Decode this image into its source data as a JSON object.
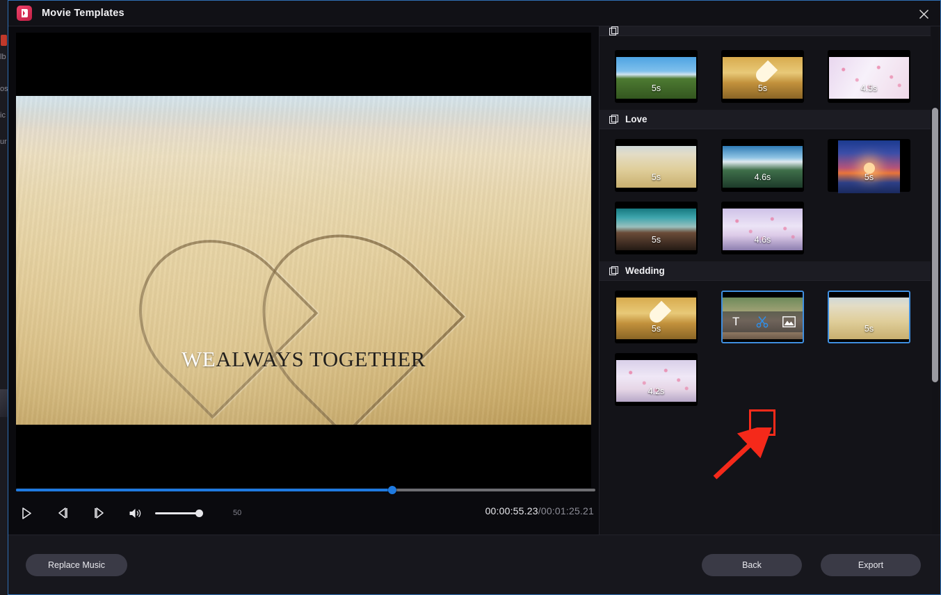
{
  "background_app": {
    "sidebar_fragments": [
      "lb",
      "os",
      "ic",
      "ur"
    ]
  },
  "dialog": {
    "title": "Movie Templates",
    "logo_icon": "filmora-logo-icon",
    "close_icon": "close-icon"
  },
  "preview": {
    "caption_highlight": "WE",
    "caption_rest": "ALWAYS TOGETHER",
    "scene_description": "heart drawn in beach sand",
    "transport": {
      "play_icon": "play-icon",
      "prev_frame_icon": "previous-frame-icon",
      "next_frame_icon": "next-frame-icon",
      "volume_icon": "volume-icon",
      "volume_value": "50",
      "current_time": "00:00:55.23",
      "separator": "/",
      "total_time": "00:01:25.21",
      "progress_percent": 65
    }
  },
  "templates": {
    "scrollbar": {
      "thumb_top_percent": 16,
      "thumb_height_percent": 54
    },
    "sections": [
      {
        "label": "",
        "icon": "stack-icon",
        "partial": true,
        "items": [
          {
            "name": "bike-couple-template",
            "duration": "5s",
            "art": "art-bike",
            "state": "normal"
          },
          {
            "name": "hands-heart-template",
            "duration": "5s",
            "art": "art-hands",
            "state": "normal"
          },
          {
            "name": "pink-petals-template",
            "duration": "4.5s",
            "art": "art-petals",
            "state": "normal"
          }
        ]
      },
      {
        "label": "Love",
        "icon": "stack-icon",
        "items": [
          {
            "name": "sand-heart-template",
            "duration": "5s",
            "art": "art-sandheart",
            "state": "normal"
          },
          {
            "name": "mountain-lake-template",
            "duration": "4.6s",
            "art": "art-lake",
            "state": "normal"
          },
          {
            "name": "ocean-sunset-template",
            "duration": "5s",
            "art": "art-sunset",
            "state": "tall"
          },
          {
            "name": "dusk-silhouette-template",
            "duration": "5s",
            "art": "art-dusk",
            "state": "normal"
          },
          {
            "name": "blossom-template",
            "duration": "4.6s",
            "art": "art-blossom",
            "state": "normal"
          }
        ]
      },
      {
        "label": "Wedding",
        "icon": "stack-icon",
        "items": [
          {
            "name": "hands-heart-wedding-template",
            "duration": "5s",
            "art": "art-hands",
            "state": "normal"
          },
          {
            "name": "wedding-couple-template",
            "duration": "",
            "art": "art-couple",
            "state": "hovered"
          },
          {
            "name": "sand-heart-wedding-template",
            "duration": "5s",
            "art": "art-sandheart",
            "state": "selected"
          },
          {
            "name": "falling-petals-template",
            "duration": "4.2s",
            "art": "art-fallpetals",
            "state": "normal"
          }
        ]
      }
    ],
    "hover_toolbar": {
      "text_icon": "text-tool-icon",
      "text_label": "T",
      "cut_icon": "scissors-cut-icon",
      "image_icon": "image-replace-icon",
      "active_tool": "scissors-cut-icon"
    }
  },
  "footer": {
    "replace_music": "Replace Music",
    "back": "Back",
    "export": "Export"
  },
  "annotation": {
    "highlight_color": "#ff2b1a",
    "arrow_color": "#f5291a",
    "target": "scissors-cut-icon"
  },
  "colors": {
    "accent_blue": "#1f7ae0",
    "selection_blue": "#3f8fe0",
    "annotation_red": "#ff2b1a",
    "panel_bg": "#131318",
    "dialog_bg": "#17171d"
  }
}
